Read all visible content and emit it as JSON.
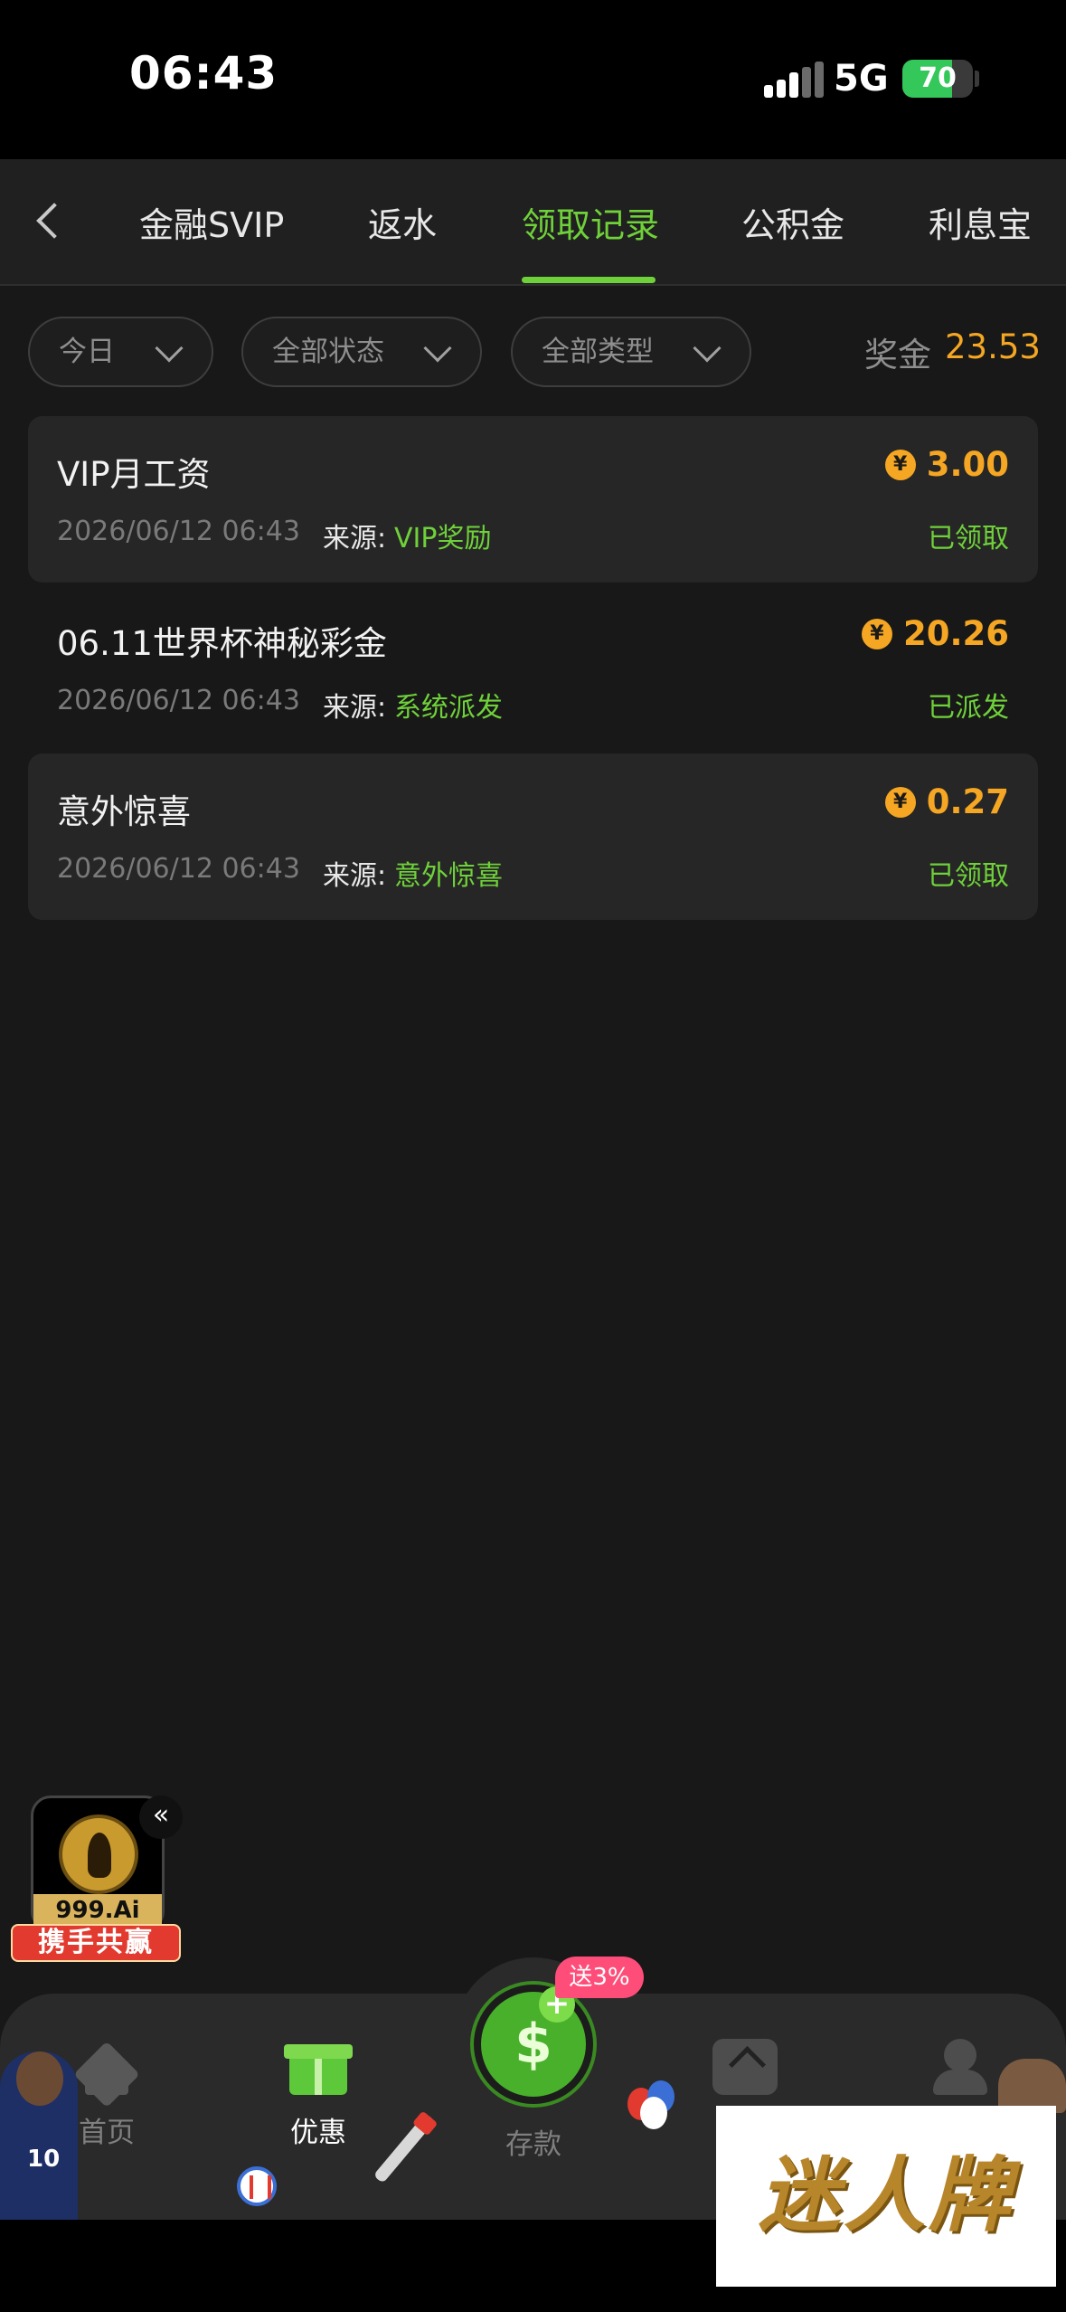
{
  "status_bar": {
    "time": "06:43",
    "network": "5G",
    "battery_level": "70",
    "battery_fraction": 0.7,
    "colors": {
      "battery": "#34c759"
    }
  },
  "top_nav": {
    "back_icon": "chevron-left-icon",
    "tabs": [
      {
        "label": "金融SVIP",
        "active": false
      },
      {
        "label": "返水",
        "active": false
      },
      {
        "label": "领取记录",
        "active": true
      },
      {
        "label": "公积金",
        "active": false
      },
      {
        "label": "利息宝",
        "active": false
      }
    ],
    "colors": {
      "active": "#6fd13a"
    }
  },
  "filters": {
    "date": "今日",
    "status": "全部状态",
    "type": "全部类型",
    "bonus_label": "奖金",
    "bonus_value": "23.53"
  },
  "records": [
    {
      "title": "VIP月工资",
      "amount": "3.00",
      "time": "2026/06/12 06:43",
      "source_label": "来源:",
      "source": "VIP奖励",
      "status": "已领取"
    },
    {
      "title": "06.11世界杯神秘彩金",
      "amount": "20.26",
      "time": "2026/06/12 06:43",
      "source_label": "来源:",
      "source": "系统派发",
      "status": "已派发"
    },
    {
      "title": "意外惊喜",
      "amount": "0.27",
      "time": "2026/06/12 06:43",
      "source_label": "来源:",
      "source": "意外惊喜",
      "status": "已领取"
    }
  ],
  "coin_symbol": "¥",
  "float_badge": {
    "brand": "999.Ai",
    "ribbon": "携手共赢",
    "collapse_icon": "«"
  },
  "bottom_nav": {
    "home": "首页",
    "promo": "优惠",
    "deposit": "存款",
    "deposit_badge": "送3%",
    "deposit_plus": "+"
  },
  "watermark": "迷人牌",
  "colors": {
    "accent_green": "#6fd13a",
    "amount_orange": "#f5a623",
    "background": "#181818"
  }
}
